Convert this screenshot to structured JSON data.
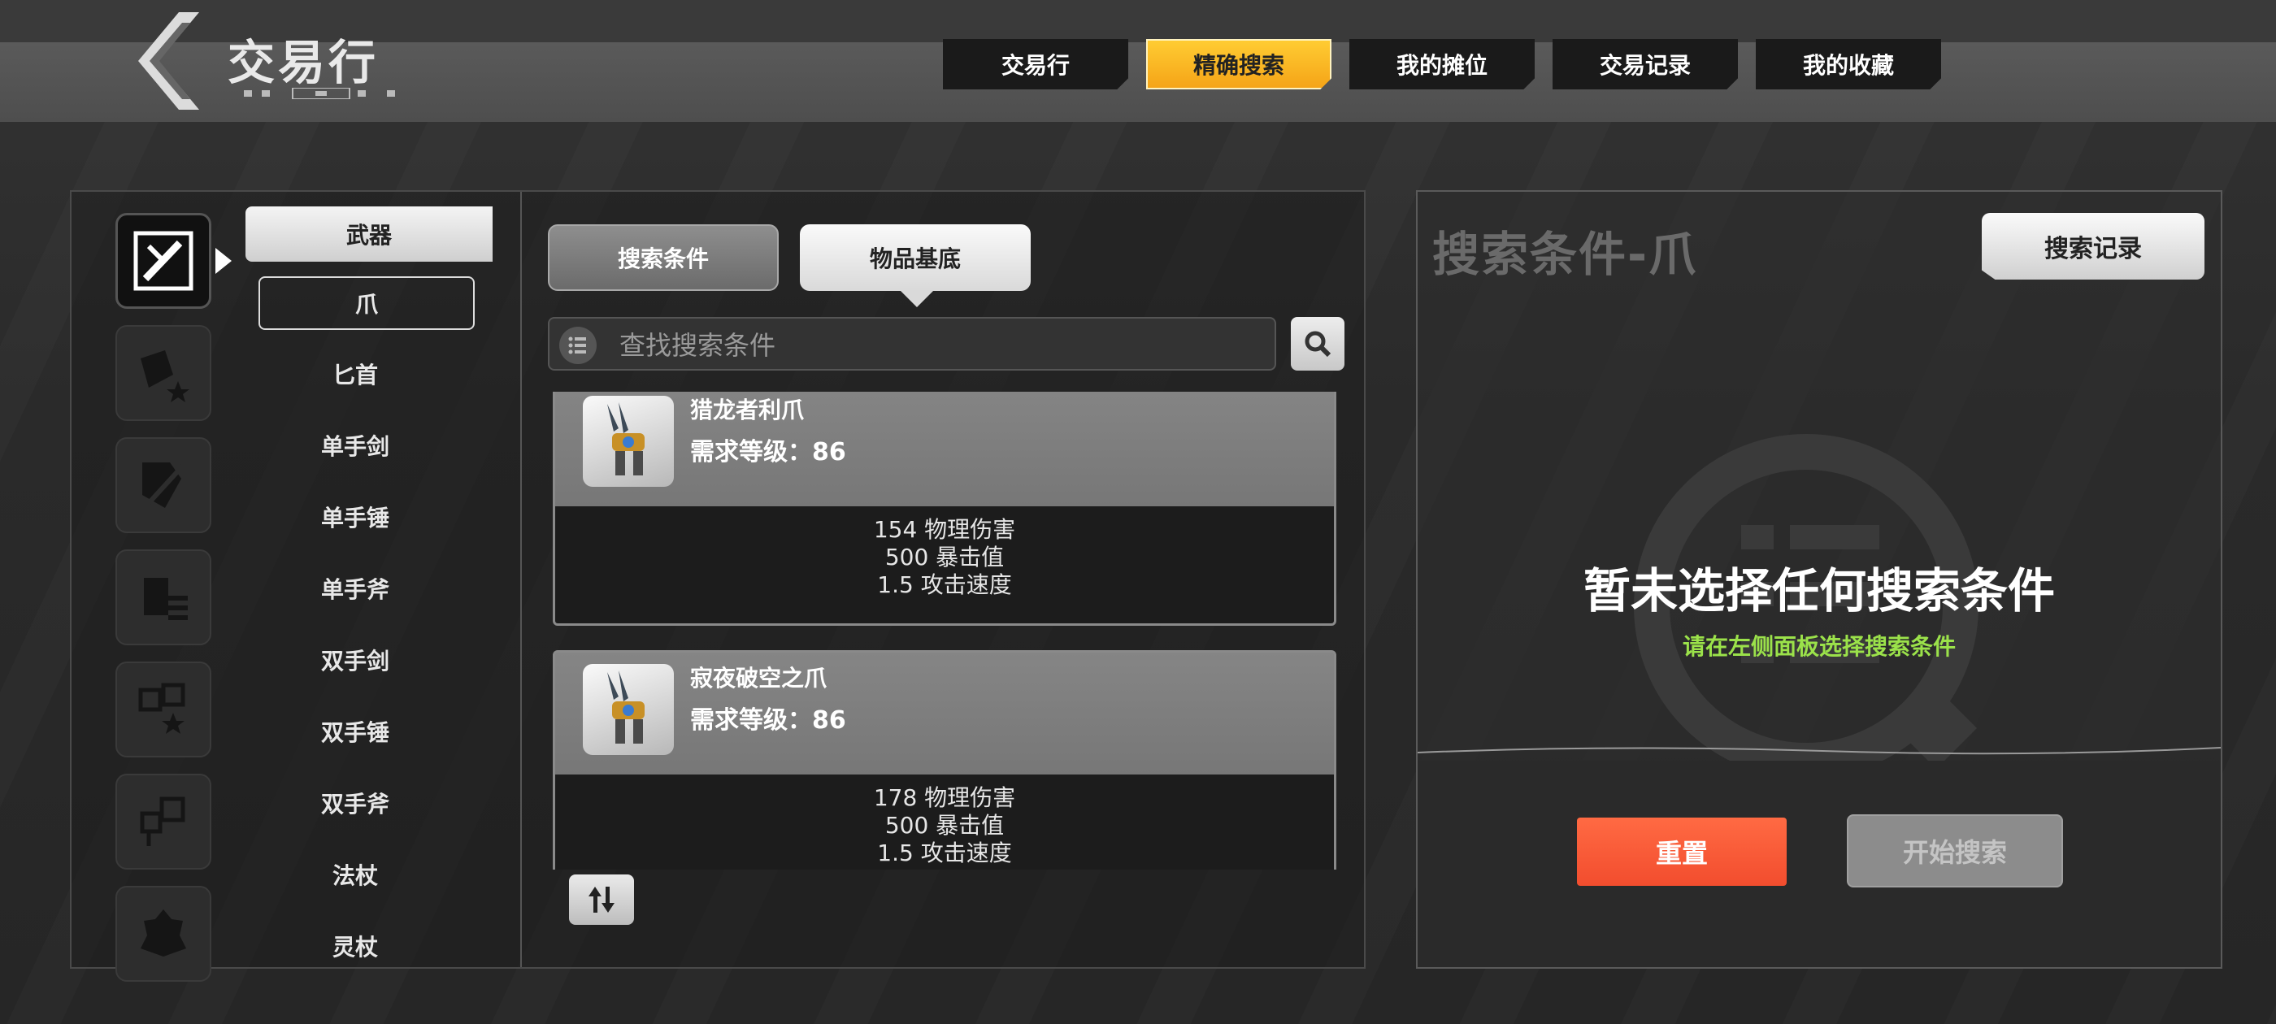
{
  "header": {
    "title": "交易行",
    "tabs": [
      {
        "label": "交易行",
        "active": false
      },
      {
        "label": "精确搜索",
        "active": true
      },
      {
        "label": "我的摊位",
        "active": false
      },
      {
        "label": "交易记录",
        "active": false
      },
      {
        "label": "我的收藏",
        "active": false
      }
    ]
  },
  "category_icons": [
    "weapon-icon",
    "trinket-icon",
    "armor-icon",
    "accessory-icon",
    "gem-icon",
    "material-icon",
    "pet-icon"
  ],
  "subcategory": {
    "header": "武器",
    "items": [
      "爪",
      "匕首",
      "单手剑",
      "单手锤",
      "单手斧",
      "双手剑",
      "双手锤",
      "双手斧",
      "法杖",
      "灵杖"
    ]
  },
  "filter_tabs": {
    "conditions": "搜索条件",
    "base": "物品基底"
  },
  "search": {
    "placeholder": "查找搜索条件"
  },
  "items": [
    {
      "name": "猎龙者利爪",
      "level": "需求等级：86",
      "stats": [
        "154 物理伤害",
        "500 暴击值",
        "1.5 攻击速度"
      ]
    },
    {
      "name": "寂夜破空之爪",
      "level": "需求等级：86",
      "stats": [
        "178 物理伤害",
        "500 暴击值",
        "1.5 攻击速度"
      ]
    }
  ],
  "right_panel": {
    "title": "搜索条件-爪",
    "history_button": "搜索记录",
    "empty_title": "暂未选择任何搜索条件",
    "empty_subtitle": "请在左侧面板选择搜索条件",
    "reset_button": "重置",
    "start_button": "开始搜索"
  },
  "colors": {
    "accent": "#f5a417",
    "reset": "#f24d2e",
    "hint": "#9be24a"
  }
}
